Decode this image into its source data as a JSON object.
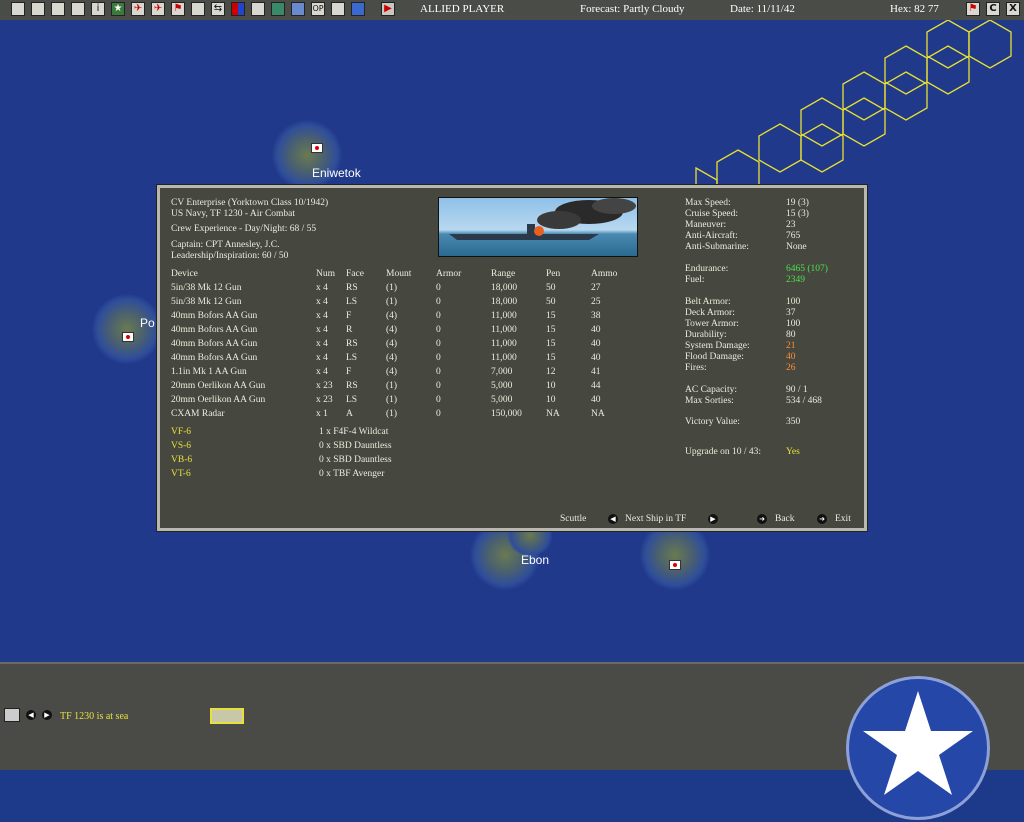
{
  "topbar": {
    "icons": [
      "menu-icon",
      "report-icon",
      "group-icon",
      "list-icon",
      "info-icon",
      "star-icon",
      "air-icon",
      "air2-icon",
      "flag-icon",
      "base-icon",
      "swap-icon",
      "tf-icon",
      "color-icon",
      "ship-icon",
      "globe-icon",
      "globe2-icon",
      "op-icon",
      "screen-icon",
      "eye-icon",
      "play-icon"
    ],
    "op_label": "OP",
    "player": "ALLIED PLAYER",
    "forecast": "Forecast: Partly Cloudy",
    "date": "Date: 11/11/42",
    "hex": "Hex: 82 77",
    "right_icons": [
      "flag-red-icon",
      "c-icon",
      "x-icon"
    ],
    "c_label": "C",
    "x_label": "X"
  },
  "map": {
    "labels": {
      "eniwetok": "Eniwetok",
      "ponape": "Po",
      "ebon": "Ebon"
    }
  },
  "panel": {
    "ship_name": "CV Enterprise (Yorktown Class 10/1942)",
    "affiliation": "US Navy, TF 1230 - Air Combat",
    "crew_exp": "Crew Experience - Day/Night: 68 / 55",
    "captain": "Captain: CPT Annesley, J.C.",
    "leadership": "Leadership/Inspiration: 60 / 50",
    "headers": {
      "device": "Device",
      "num": "Num",
      "face": "Face",
      "mount": "Mount",
      "armor": "Armor",
      "range": "Range",
      "pen": "Pen",
      "ammo": "Ammo"
    },
    "devices": [
      {
        "device": "5in/38 Mk 12 Gun",
        "num": "x 4",
        "face": "RS",
        "mount": "(1)",
        "armor": "0",
        "range": "18,000",
        "pen": "50",
        "ammo": "27"
      },
      {
        "device": "5in/38 Mk 12 Gun",
        "num": "x 4",
        "face": "LS",
        "mount": "(1)",
        "armor": "0",
        "range": "18,000",
        "pen": "50",
        "ammo": "25"
      },
      {
        "device": "40mm Bofors AA Gun",
        "num": "x 4",
        "face": "F",
        "mount": "(4)",
        "armor": "0",
        "range": "11,000",
        "pen": "15",
        "ammo": "38"
      },
      {
        "device": "40mm Bofors AA Gun",
        "num": "x 4",
        "face": "R",
        "mount": "(4)",
        "armor": "0",
        "range": "11,000",
        "pen": "15",
        "ammo": "40"
      },
      {
        "device": "40mm Bofors AA Gun",
        "num": "x 4",
        "face": "RS",
        "mount": "(4)",
        "armor": "0",
        "range": "11,000",
        "pen": "15",
        "ammo": "40"
      },
      {
        "device": "40mm Bofors AA Gun",
        "num": "x 4",
        "face": "LS",
        "mount": "(4)",
        "armor": "0",
        "range": "11,000",
        "pen": "15",
        "ammo": "40"
      },
      {
        "device": "1.1in Mk 1 AA Gun",
        "num": "x 4",
        "face": "F",
        "mount": "(4)",
        "armor": "0",
        "range": "7,000",
        "pen": "12",
        "ammo": "41"
      },
      {
        "device": "20mm Oerlikon AA Gun",
        "num": "x 23",
        "face": "RS",
        "mount": "(1)",
        "armor": "0",
        "range": "5,000",
        "pen": "10",
        "ammo": "44"
      },
      {
        "device": "20mm Oerlikon AA Gun",
        "num": "x 23",
        "face": "LS",
        "mount": "(1)",
        "armor": "0",
        "range": "5,000",
        "pen": "10",
        "ammo": "40"
      },
      {
        "device": "CXAM Radar",
        "num": "x 1",
        "face": "A",
        "mount": "(1)",
        "armor": "0",
        "range": "150,000",
        "pen": "NA",
        "ammo": "NA"
      }
    ],
    "squadrons": [
      {
        "name": "VF-6",
        "aircraft": "1 x F4F-4 Wildcat"
      },
      {
        "name": "VS-6",
        "aircraft": "0 x SBD Dauntless"
      },
      {
        "name": "VB-6",
        "aircraft": "0 x SBD Dauntless"
      },
      {
        "name": "VT-6",
        "aircraft": "0 x TBF Avenger"
      }
    ],
    "stats": {
      "max_speed": {
        "label": "Max Speed:",
        "value": "19 (3)"
      },
      "cruise_speed": {
        "label": "Cruise Speed:",
        "value": "15 (3)"
      },
      "maneuver": {
        "label": "Maneuver:",
        "value": "23"
      },
      "anti_aircraft": {
        "label": "Anti-Aircraft:",
        "value": "765"
      },
      "anti_sub": {
        "label": "Anti-Submarine:",
        "value": "None"
      },
      "endurance": {
        "label": "Endurance:",
        "value": "6465 (107)"
      },
      "fuel": {
        "label": "Fuel:",
        "value": "2349"
      },
      "belt_armor": {
        "label": "Belt Armor:",
        "value": "100"
      },
      "deck_armor": {
        "label": "Deck Armor:",
        "value": "37"
      },
      "tower_armor": {
        "label": "Tower Armor:",
        "value": "100"
      },
      "durability": {
        "label": "Durability:",
        "value": "80"
      },
      "system_damage": {
        "label": "System Damage:",
        "value": "21"
      },
      "flood_damage": {
        "label": "Flood Damage:",
        "value": "40"
      },
      "fires": {
        "label": "Fires:",
        "value": "26"
      },
      "ac_capacity": {
        "label": "AC Capacity:",
        "value": "90 / 1"
      },
      "max_sorties": {
        "label": "Max Sorties:",
        "value": "534 / 468"
      },
      "victory_value": {
        "label": "Victory Value:",
        "value": "350"
      },
      "upgrade": {
        "label": "Upgrade on 10 / 43:",
        "value": "Yes"
      }
    },
    "buttons": {
      "scuttle": "Scuttle",
      "next_ship": "Next Ship in TF",
      "back": "Back",
      "exit": "Exit"
    }
  },
  "bottom": {
    "status": "TF 1230 is at sea"
  }
}
